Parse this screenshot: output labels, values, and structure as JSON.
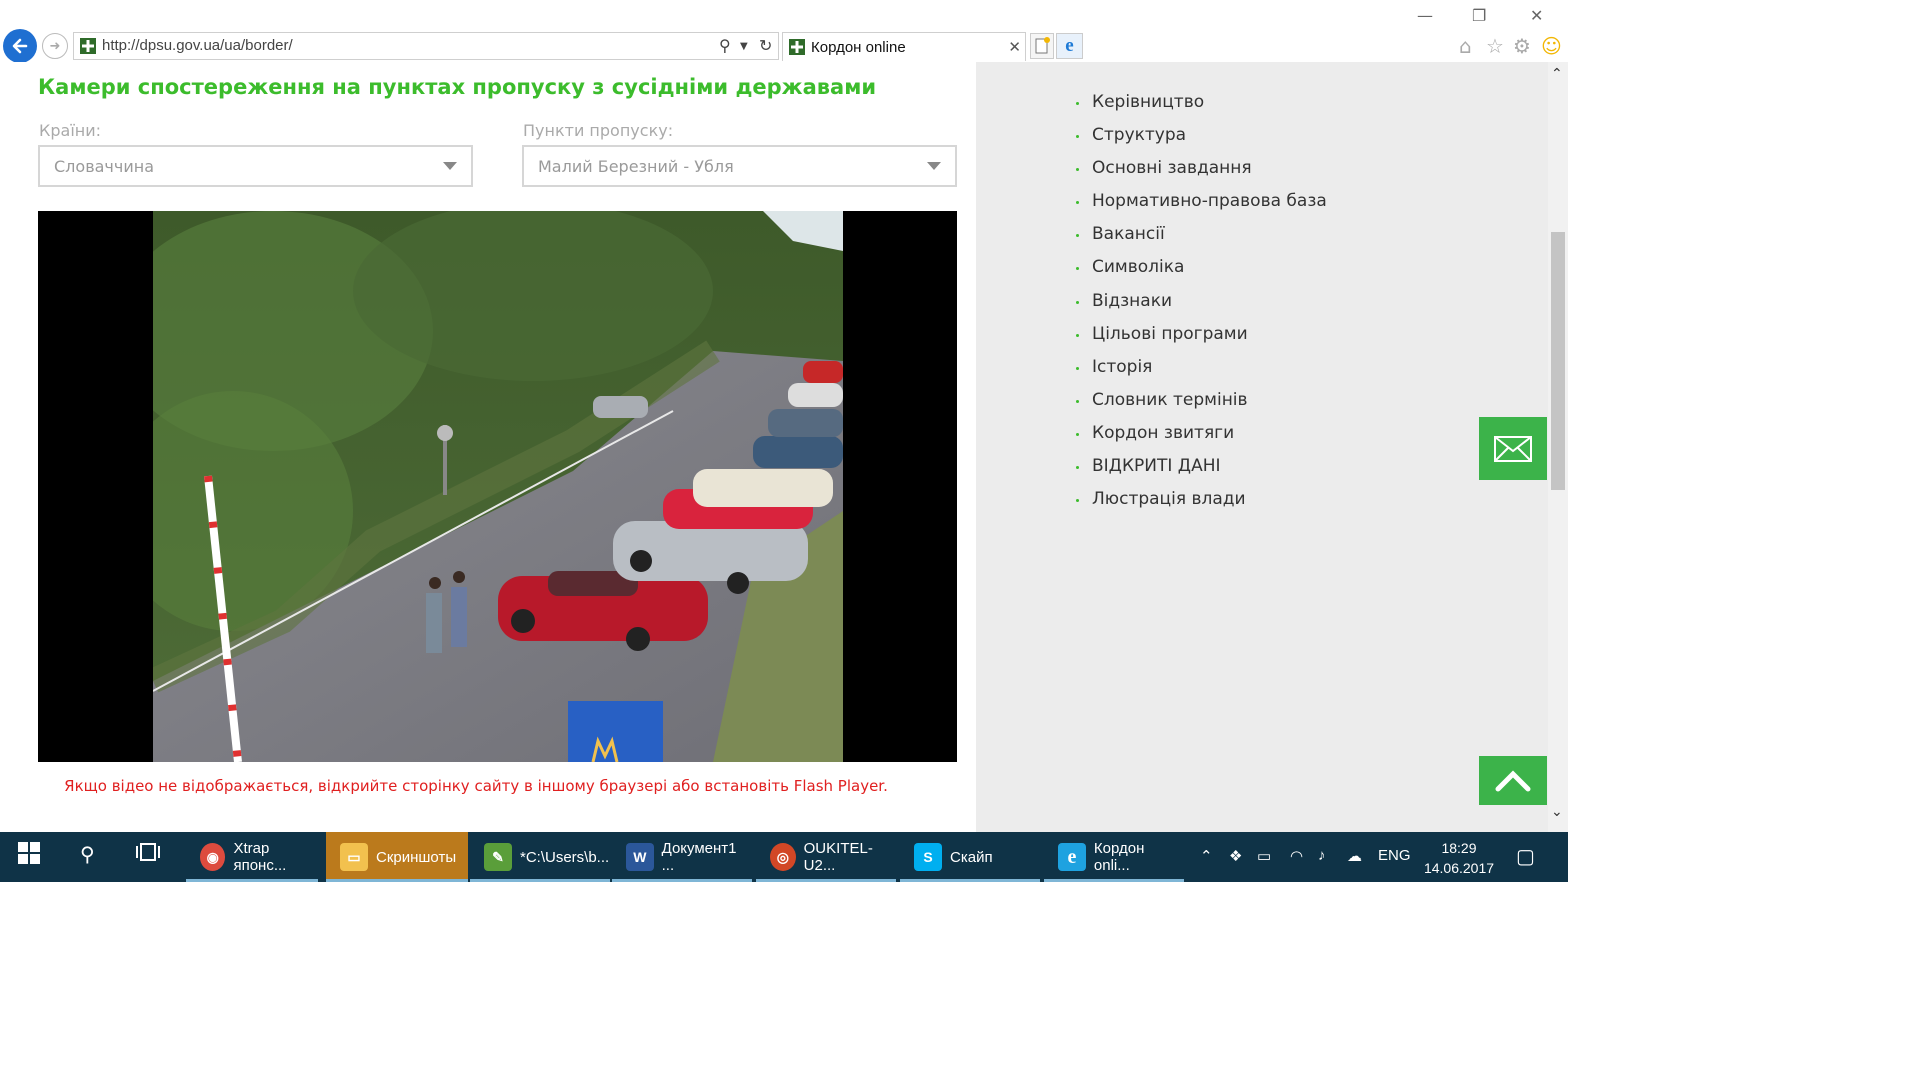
{
  "browser": {
    "url": "http://dpsu.gov.ua/ua/border/",
    "tab_title": "Кордон online",
    "tab_close": "✕",
    "window": {
      "minimize": "—",
      "restore": "❐",
      "close": "✕"
    }
  },
  "page": {
    "title": "Камери спостереження на пунктах пропуску з сусідніми державами",
    "countries_label": "Країни:",
    "countries_value": "Словаччина",
    "checkpoints_label": "Пункти пропуску:",
    "checkpoints_value": "Малий Березний - Убля",
    "video_notice": "Якщо відео не відображається, відкрийте сторінку сайту в іншому браузері або встановіть Flash Player."
  },
  "sidebar": {
    "items": [
      "Керівництво",
      "Структура",
      "Основні завдання",
      "Нормативно-правова база",
      "Вакансії",
      "Символіка",
      "Відзнаки",
      "Цільові програми",
      "Історія",
      "Словник термінів",
      "Кордон звитяги",
      "ВІДКРИТІ ДАНІ",
      "Люстрація влади"
    ]
  },
  "taskbar": {
    "items": [
      {
        "label": "Xtrap японс...",
        "icon": "chrome-icon",
        "color": "#dd4b3e"
      },
      {
        "label": "Скриншоты",
        "icon": "folder-icon",
        "color": "#f2c14e"
      },
      {
        "label": "*C:\\Users\\b...",
        "icon": "notepad-icon",
        "color": "#5a9e3a"
      },
      {
        "label": "Документ1 ...",
        "icon": "word-icon",
        "color": "#2b579a"
      },
      {
        "label": "OUKITEL-U2...",
        "icon": "eye-app-icon",
        "color": "#d24726"
      },
      {
        "label": "Скайп",
        "icon": "skype-icon",
        "color": "#00aff0"
      },
      {
        "label": "Кордон onli...",
        "icon": "ie-icon",
        "color": "#1ea2e0"
      }
    ],
    "language": "ENG",
    "time": "18:29",
    "date": "14.06.2017"
  },
  "colors": {
    "accent_green": "#3cbc2c",
    "notice_red": "#e02020",
    "sidebar_bg": "#ececec",
    "button_green": "#3cb34a",
    "taskbar_bg": "#0f3347"
  }
}
